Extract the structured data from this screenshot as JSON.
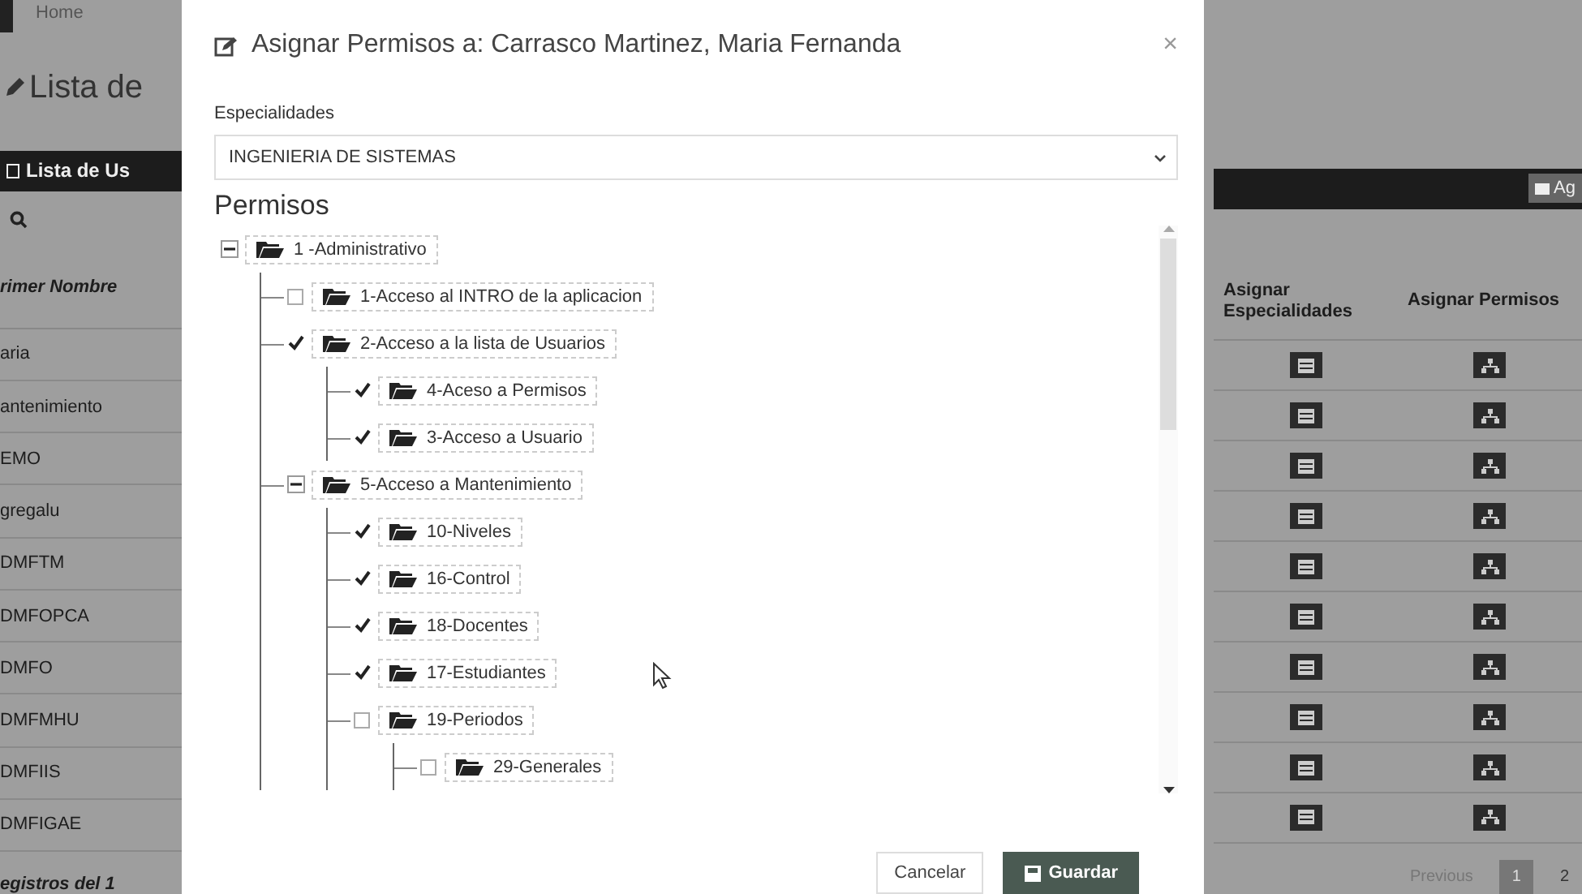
{
  "background_page": {
    "breadcrumb": "Home",
    "heading": "Lista de",
    "panel_title": "Lista de Us",
    "panel_button": "Ag",
    "columns": [
      "rimer Nombre",
      "Asignar Especialidades",
      "Asignar Permisos"
    ],
    "rows": [
      "aria",
      "antenimiento",
      "EMO",
      "gregalu",
      "DMFTM",
      "DMFOPCA",
      "DMFO",
      "DMFMHU",
      "DMFIIS",
      "DMFIGAE"
    ],
    "footer_info": "egistros del 1",
    "pagination": [
      {
        "label": "Previous",
        "selected": false
      },
      {
        "label": "1",
        "selected": true
      },
      {
        "label": "2",
        "selected": false
      }
    ]
  },
  "dialog": {
    "title": "Asignar Permisos a: Carrasco Martinez, Maria Fernanda",
    "close": "×",
    "field": {
      "label": "Especialidades",
      "value": "INGENIERIA DE SISTEMAS"
    },
    "section_title": "Permisos",
    "tree": [
      {
        "label": "1 -Administrativo",
        "kind": "toggle",
        "expanded": true,
        "children": [
          {
            "label": "1-Acceso al INTRO de la aplicacion",
            "kind": "checkbox",
            "checked": false
          },
          {
            "label": "2-Acceso a la lista de Usuarios",
            "kind": "checkbox",
            "checked": true,
            "children": [
              {
                "label": "4-Aceso a Permisos",
                "kind": "checkbox",
                "checked": true
              },
              {
                "label": "3-Acceso a Usuario",
                "kind": "checkbox",
                "checked": true
              }
            ]
          },
          {
            "label": "5-Acceso a Mantenimiento",
            "kind": "toggle",
            "expanded": true,
            "children": [
              {
                "label": "10-Niveles",
                "kind": "checkbox",
                "checked": true
              },
              {
                "label": "16-Control",
                "kind": "checkbox",
                "checked": true
              },
              {
                "label": "18-Docentes",
                "kind": "checkbox",
                "checked": true
              },
              {
                "label": "17-Estudiantes",
                "kind": "checkbox",
                "checked": true
              },
              {
                "label": "19-Periodos",
                "kind": "checkbox",
                "checked": false,
                "children": [
                  {
                    "label": "29-Generales",
                    "kind": "checkbox",
                    "checked": false
                  }
                ]
              }
            ]
          }
        ]
      }
    ],
    "buttons": [
      {
        "label": "Cancelar",
        "kind": "secondary"
      },
      {
        "label": "Guardar",
        "kind": "primary"
      }
    ]
  }
}
